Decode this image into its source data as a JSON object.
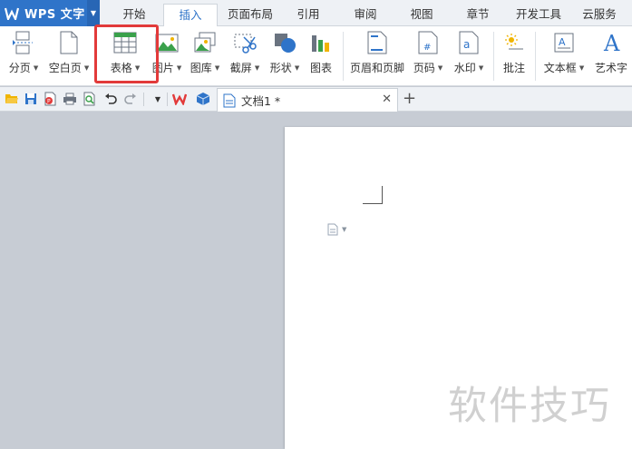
{
  "app": {
    "name": "WPS 文字",
    "brand_color": "#2f74c9"
  },
  "menu_tabs": [
    {
      "label": "开始"
    },
    {
      "label": "插入"
    },
    {
      "label": "页面布局"
    },
    {
      "label": "引用"
    },
    {
      "label": "审阅"
    },
    {
      "label": "视图"
    },
    {
      "label": "章节"
    },
    {
      "label": "开发工具"
    },
    {
      "label": "云服务"
    }
  ],
  "active_tab": "插入",
  "ribbon": {
    "page_break": "分页",
    "blank_page": "空白页",
    "table": "表格",
    "picture": "图片",
    "gallery": "图库",
    "screenshot": "截屏",
    "shapes": "形状",
    "chart": "图表",
    "header_footer": "页眉和页脚",
    "page_number": "页码",
    "watermark": "水印",
    "comment": "批注",
    "textbox": "文本框",
    "wordart": "艺术字"
  },
  "highlighted_button": "表格",
  "document_tab": {
    "title": "文档1 *"
  },
  "watermark_text": "软件技巧"
}
